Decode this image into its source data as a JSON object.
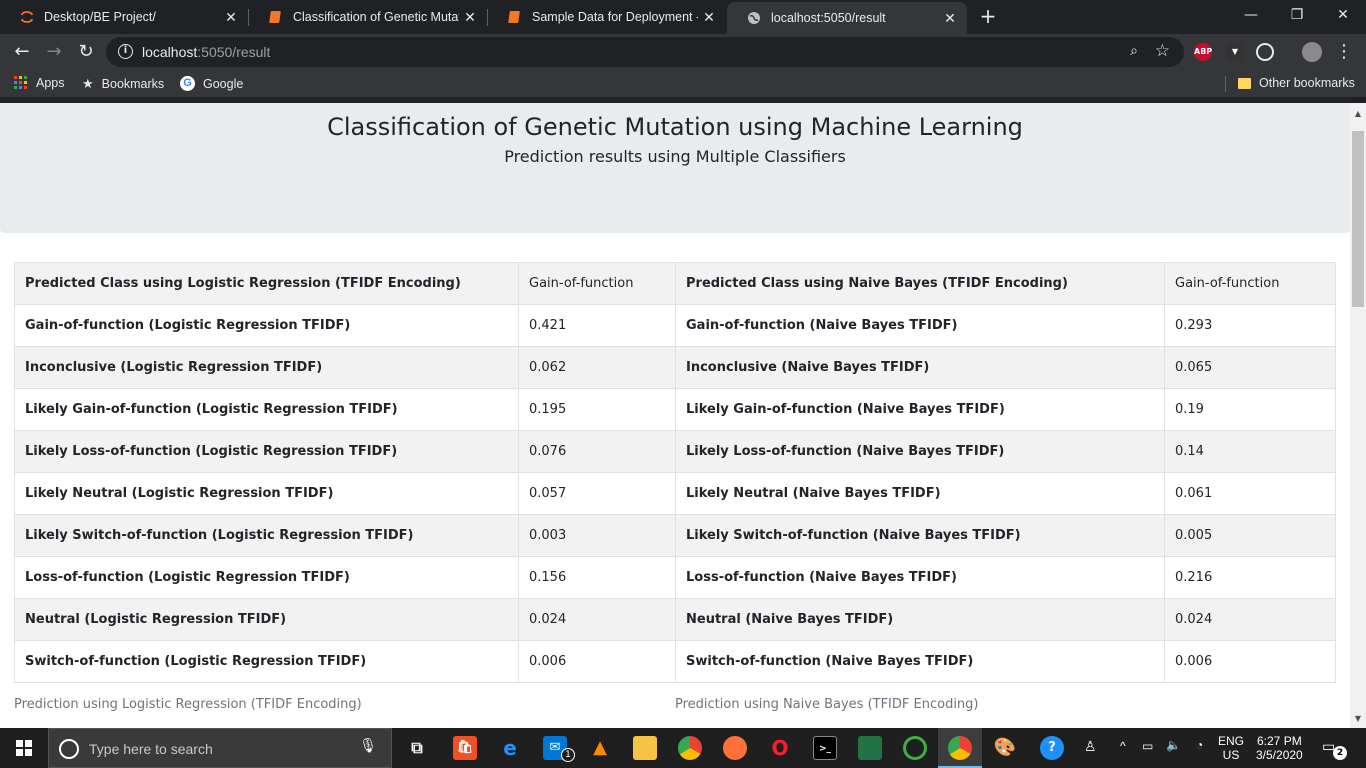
{
  "browser": {
    "tabs": [
      {
        "title": "Desktop/BE Project/",
        "icon": "jupyter-icon"
      },
      {
        "title": "Classification of Genetic Mutatio",
        "icon": "jupyter-notebook-icon"
      },
      {
        "title": "Sample Data for Deployment - Ju",
        "icon": "jupyter-notebook-icon"
      },
      {
        "title": "localhost:5050/result",
        "icon": "globe-icon"
      }
    ],
    "url_host": "localhost",
    "url_rest": ":5050/result",
    "bookmarks": [
      {
        "label": "Apps",
        "icon": "apps-grid-icon"
      },
      {
        "label": "Bookmarks",
        "icon": "star-icon"
      },
      {
        "label": "Google",
        "icon": "google-icon"
      }
    ],
    "other_bookmarks": "Other bookmarks",
    "extensions": [
      {
        "label": "ABP",
        "color": "#c70d2c"
      }
    ]
  },
  "page": {
    "title": "Classification of Genetic Mutation using Machine Learning",
    "subtitle": "Prediction results using Multiple Classifiers",
    "tables": [
      {
        "header_label": "Predicted Class using Logistic Regression (TFIDF Encoding)",
        "header_value": "Gain-of-function",
        "rows": [
          {
            "label": "Gain-of-function (Logistic Regression TFIDF)",
            "value": "0.421"
          },
          {
            "label": "Inconclusive (Logistic Regression TFIDF)",
            "value": "0.062"
          },
          {
            "label": "Likely Gain-of-function (Logistic Regression TFIDF)",
            "value": "0.195"
          },
          {
            "label": "Likely Loss-of-function (Logistic Regression TFIDF)",
            "value": "0.076"
          },
          {
            "label": "Likely Neutral (Logistic Regression TFIDF)",
            "value": "0.057"
          },
          {
            "label": "Likely Switch-of-function (Logistic Regression TFIDF)",
            "value": "0.003"
          },
          {
            "label": "Loss-of-function (Logistic Regression TFIDF)",
            "value": "0.156"
          },
          {
            "label": "Neutral (Logistic Regression TFIDF)",
            "value": "0.024"
          },
          {
            "label": "Switch-of-function (Logistic Regression TFIDF)",
            "value": "0.006"
          }
        ],
        "caption": "Prediction using Logistic Regression (TFIDF Encoding)"
      },
      {
        "header_label": "Predicted Class using Naive Bayes (TFIDF Encoding)",
        "header_value": "Gain-of-function",
        "rows": [
          {
            "label": "Gain-of-function (Naive Bayes TFIDF)",
            "value": "0.293"
          },
          {
            "label": "Inconclusive (Naive Bayes TFIDF)",
            "value": "0.065"
          },
          {
            "label": "Likely Gain-of-function (Naive Bayes TFIDF)",
            "value": "0.19"
          },
          {
            "label": "Likely Loss-of-function (Naive Bayes TFIDF)",
            "value": "0.14"
          },
          {
            "label": "Likely Neutral (Naive Bayes TFIDF)",
            "value": "0.061"
          },
          {
            "label": "Likely Switch-of-function (Naive Bayes TFIDF)",
            "value": "0.005"
          },
          {
            "label": "Loss-of-function (Naive Bayes TFIDF)",
            "value": "0.216"
          },
          {
            "label": "Neutral (Naive Bayes TFIDF)",
            "value": "0.024"
          },
          {
            "label": "Switch-of-function (Naive Bayes TFIDF)",
            "value": "0.006"
          }
        ],
        "caption": "Prediction using Naive Bayes (TFIDF Encoding)"
      }
    ]
  },
  "taskbar": {
    "search_placeholder": "Type here to search",
    "mail_badge": "1",
    "lang_top": "ENG",
    "lang_bottom": "US",
    "time": "6:27 PM",
    "date": "3/5/2020",
    "notification_count": "2"
  },
  "colors": {
    "chrome_dark": "#202124",
    "toolbar": "#35363a",
    "jumbotron": "#e9ecef",
    "stripe": "#f2f2f2"
  }
}
